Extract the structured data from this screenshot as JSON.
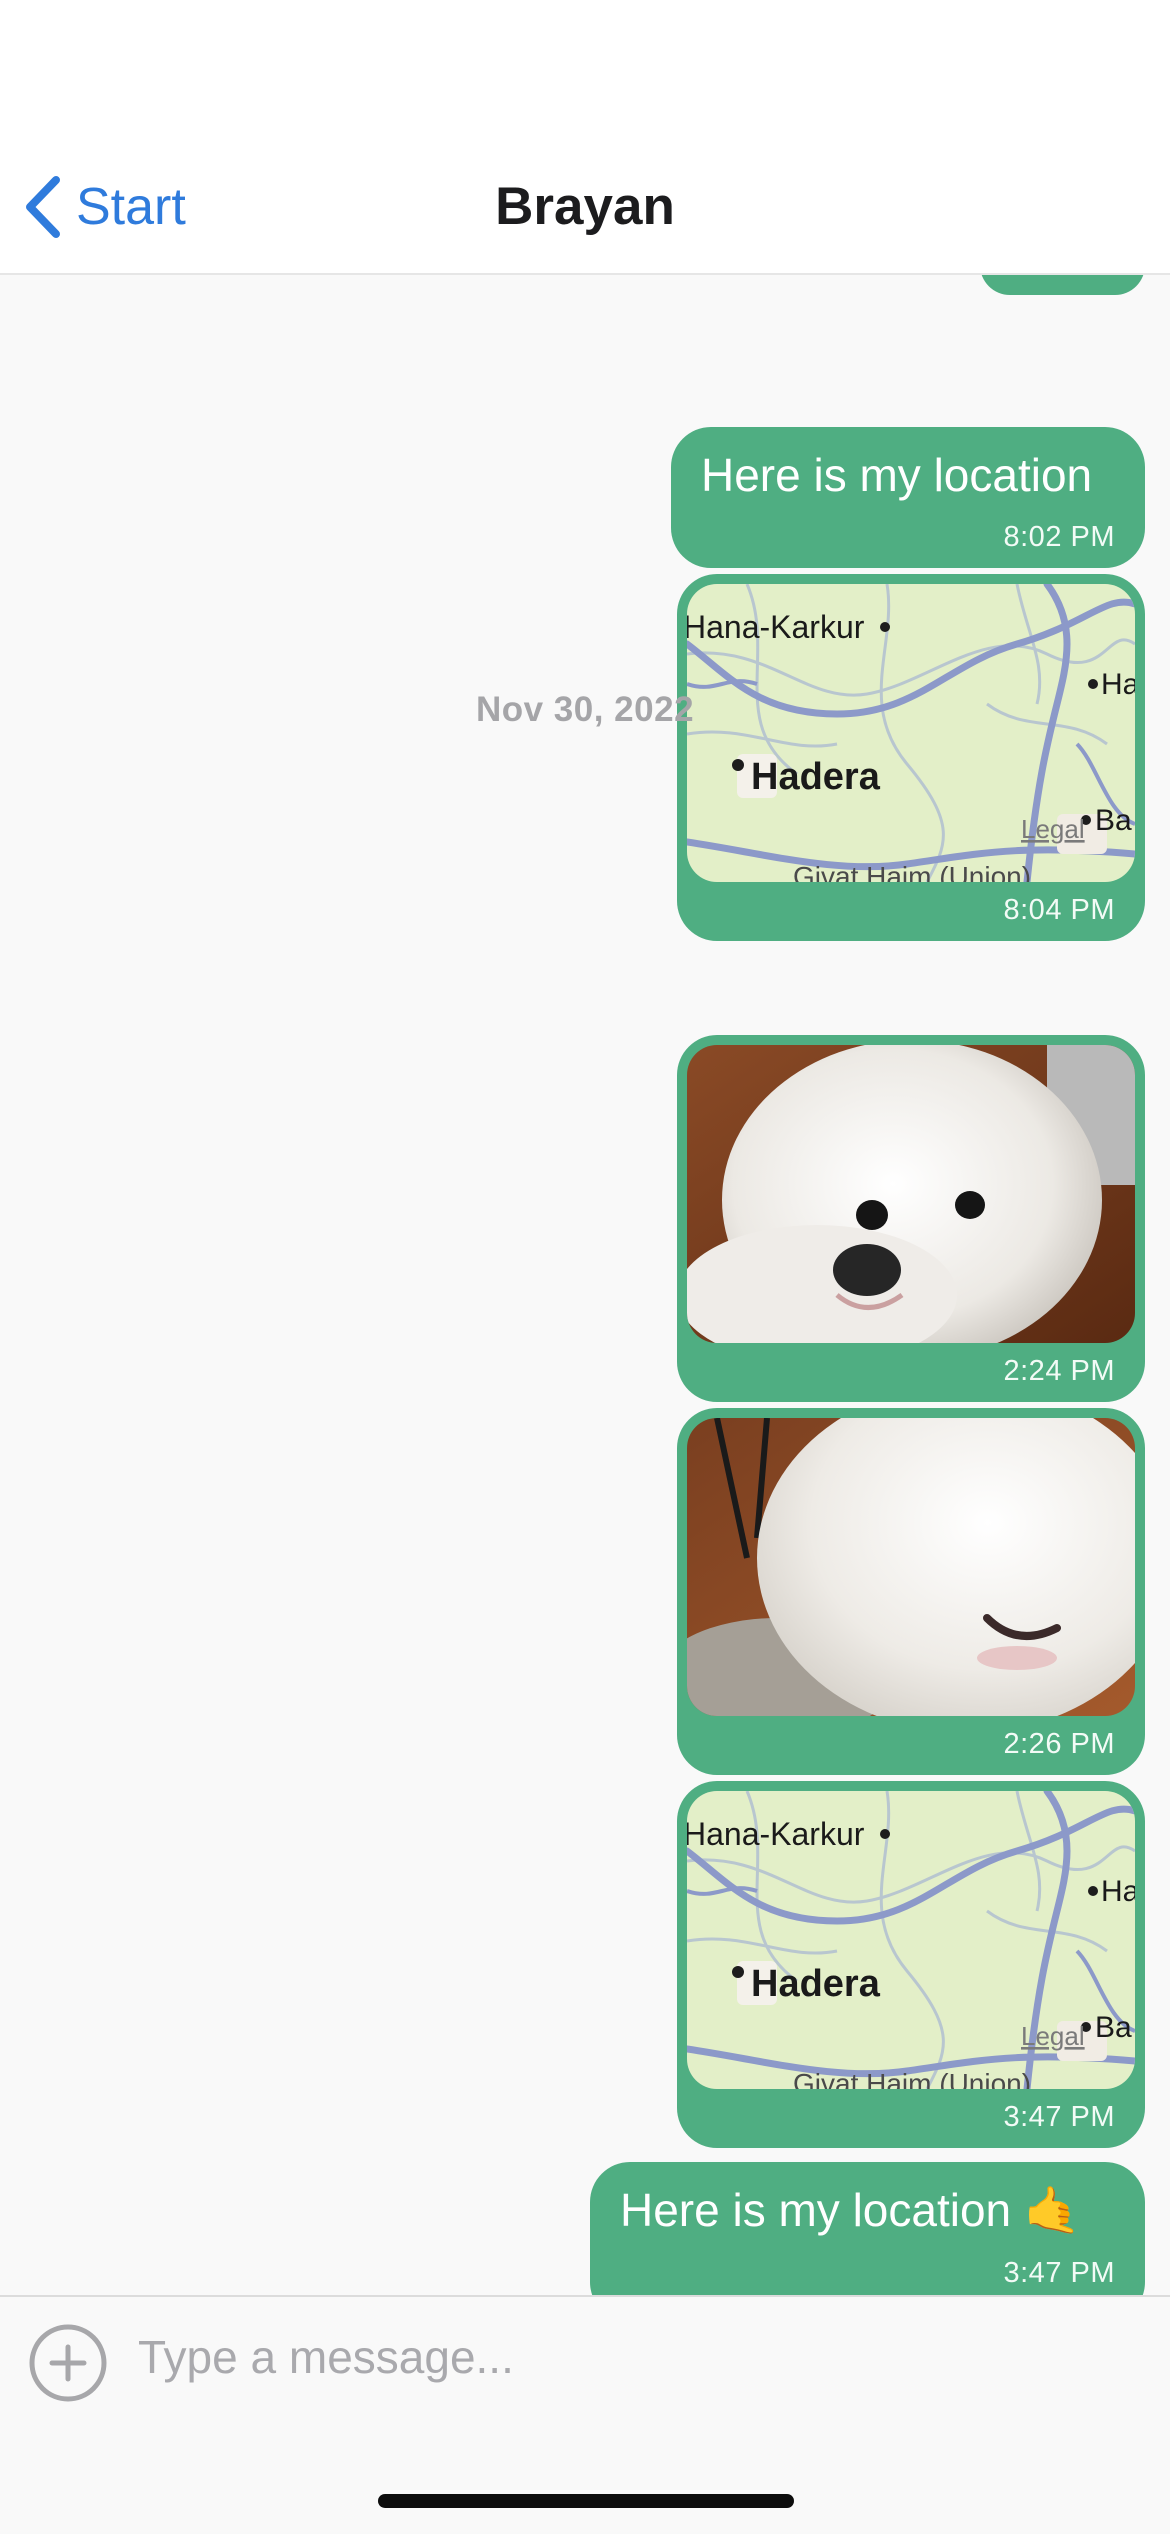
{
  "header": {
    "back_label": "Start",
    "title": "Brayan"
  },
  "messages": [
    {
      "type": "text",
      "text": "Here is my location",
      "time": "8:02 PM"
    },
    {
      "type": "map",
      "labels": [
        "Hana-Karkur",
        "Hadera",
        "Ha",
        "Ba",
        "Legal",
        "Givat Haim (Union)"
      ],
      "time": "8:04 PM"
    },
    {
      "type": "separator",
      "text": "Nov 30, 2022"
    },
    {
      "type": "image",
      "icon": "dog-photo",
      "time": "2:24 PM"
    },
    {
      "type": "image",
      "icon": "dog-photo",
      "time": "2:26 PM"
    },
    {
      "type": "map",
      "labels": [
        "Hana-Karkur",
        "Hadera",
        "Ha",
        "Ba",
        "Legal",
        "Givat Haim (Union)"
      ],
      "time": "3:47 PM"
    },
    {
      "type": "text",
      "text": "Here is my location 🤙",
      "time": "3:47 PM"
    }
  ],
  "composer": {
    "placeholder": "Type a message...",
    "attach_icon": "plus-circle-icon"
  },
  "colors": {
    "accent": "#2f7bdc",
    "bubble": "#4fae82",
    "background": "#f9f9f9"
  }
}
